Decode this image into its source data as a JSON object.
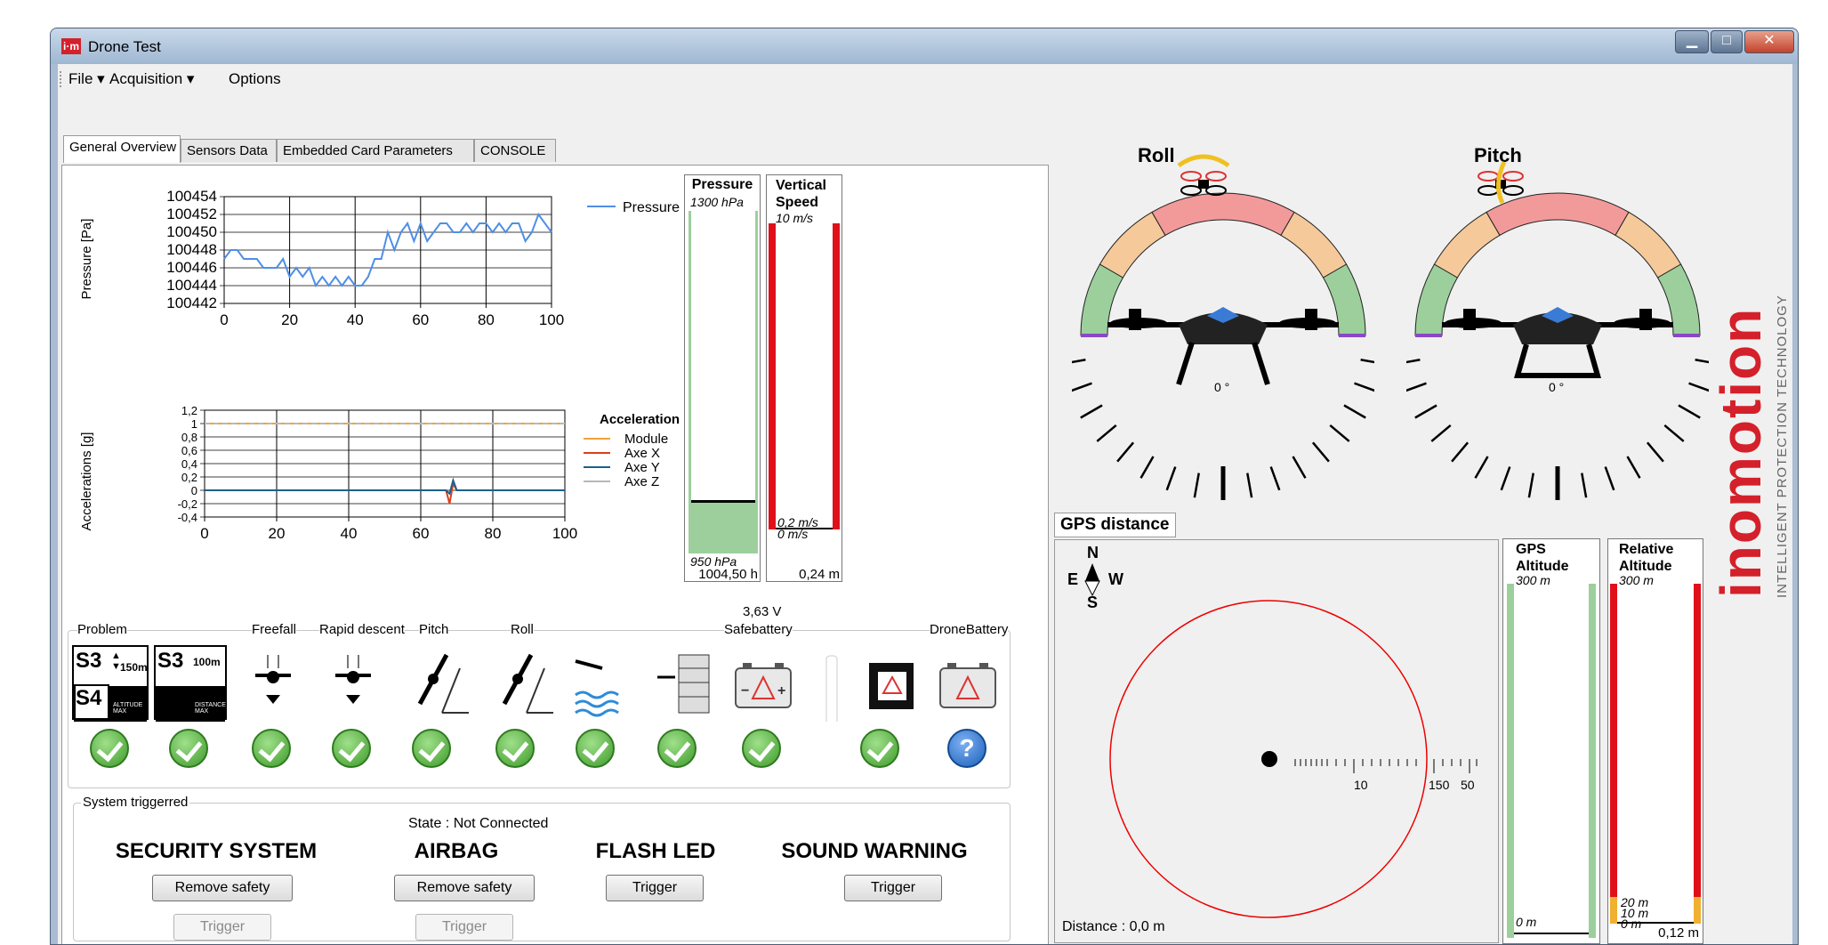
{
  "window": {
    "title": "Drone Test",
    "app_icon_text": "i·m",
    "minimize": "▁",
    "maximize": "□",
    "close": "✕"
  },
  "menu": [
    {
      "label": "File ▾"
    },
    {
      "label": "Acquisition ▾"
    },
    {
      "label": "Options"
    }
  ],
  "tabs": [
    {
      "label": "General Overview"
    },
    {
      "label": "Sensors Data"
    },
    {
      "label": "Embedded Card Parameters"
    },
    {
      "label": "CONSOLE"
    }
  ],
  "chart_data": [
    {
      "type": "line",
      "ylabel": "Pressure [Pa]",
      "xlabel": "",
      "ylim": [
        100442,
        100454
      ],
      "xlim": [
        0,
        100
      ],
      "y_ticks": [
        "100454",
        "100452",
        "100450",
        "100448",
        "100446",
        "100444",
        "100442"
      ],
      "x_ticks": [
        "0",
        "20",
        "40",
        "60",
        "80",
        "100"
      ],
      "legend": "top-right",
      "grid": true,
      "series": [
        {
          "name": "Pressure",
          "color": "#4f8fe6",
          "x": [
            0,
            2,
            4,
            6,
            8,
            10,
            12,
            14,
            16,
            18,
            20,
            22,
            24,
            26,
            28,
            30,
            32,
            34,
            36,
            38,
            40,
            42,
            44,
            46,
            48,
            50,
            52,
            54,
            56,
            58,
            60,
            62,
            64,
            66,
            68,
            70,
            72,
            74,
            76,
            78,
            80,
            82,
            84,
            86,
            88,
            90,
            92,
            94,
            96,
            98,
            100
          ],
          "y": [
            100447,
            100448,
            100448,
            100447,
            100447,
            100447,
            100446,
            100446,
            100446,
            100447,
            100445,
            100446,
            100445,
            100446,
            100444,
            100445,
            100444,
            100445,
            100444,
            100445,
            100444,
            100444,
            100445,
            100447,
            100447,
            100450,
            100448,
            100450,
            100451,
            100449,
            100451,
            100449,
            100450,
            100451,
            100451,
            100450,
            100450,
            100451,
            100450,
            100451,
            100451,
            100450,
            100451,
            100450,
            100451,
            100451,
            100449,
            100450,
            100452,
            100451,
            100450
          ]
        }
      ]
    },
    {
      "type": "line",
      "ylabel": "Accelerations [g]",
      "xlabel": "",
      "ylim": [
        -0.4,
        1.2
      ],
      "xlim": [
        0,
        100
      ],
      "y_ticks": [
        "1,2",
        "1",
        "0,8",
        "0,6",
        "0,4",
        "0,2",
        "0",
        "-0,2",
        "-0,4"
      ],
      "x_ticks": [
        "0",
        "20",
        "40",
        "60",
        "80",
        "100"
      ],
      "legend_title": "Acceleration",
      "legend": "top-right",
      "grid": true,
      "series": [
        {
          "name": "Module",
          "color": "#f2a23a",
          "x": [
            0,
            100
          ],
          "y": [
            1,
            1
          ]
        },
        {
          "name": "Axe X",
          "color": "#d9401a",
          "x": [
            0,
            67,
            68,
            69,
            70,
            100
          ],
          "y": [
            0,
            0,
            -0.2,
            0.1,
            0,
            0
          ]
        },
        {
          "name": "Axe Y",
          "color": "#1f5f8b",
          "x": [
            0,
            67,
            68,
            69,
            70,
            100
          ],
          "y": [
            0,
            0,
            -0.05,
            0.15,
            0,
            0
          ]
        },
        {
          "name": "Axe Z",
          "color": "#b8b8b8",
          "x": [
            0,
            100
          ],
          "y": [
            1,
            1
          ]
        }
      ]
    }
  ],
  "pressure_bar": {
    "title": "Pressure",
    "max_label": "1300 hPa",
    "min_label": "950 hPa",
    "value_label": "1004,50 h",
    "level": 0.155
  },
  "vspeed_bar": {
    "title": "Vertical\nSpeed",
    "max_label": "10 m/s",
    "mid_label": "0,2 m/s",
    "mid_label2": "0 m/s",
    "value_label": "0,24 m",
    "level": 0.02
  },
  "alarms": {
    "labels": {
      "problem": "Problem",
      "freefall": "Freefall",
      "rapid": "Rapid descent",
      "pitch": "Pitch",
      "roll": "Roll",
      "safebattery": "Safebattery",
      "safebattery_value": "3,63 V",
      "dronebattery": "DroneBattery"
    },
    "s3a": "S3",
    "s4": "S4",
    "s3b": "S3",
    "alt_max": "150m",
    "alt_max_caption": "ALTITUDE MAX",
    "dist_max": "100m",
    "dist_max_caption": "DISTANCE MAX",
    "unknown": "?"
  },
  "system": {
    "group_label": "System triggerred",
    "state": "State : Not Connected",
    "security_title": "SECURITY SYSTEM",
    "airbag_title": "AIRBAG",
    "flash_title": "FLASH LED",
    "sound_title": "SOUND WARNING",
    "remove_safety": "Remove safety",
    "trigger": "Trigger"
  },
  "gauges": {
    "roll_title": "Roll",
    "pitch_title": "Pitch",
    "roll_value": "0 °",
    "pitch_value": "0 °",
    "colors": {
      "green": "#9ccf9c",
      "orange": "#f5c99a",
      "red": "#f29a9a",
      "purple": "#8a48c8"
    }
  },
  "gps": {
    "tab": "GPS distance",
    "distance": "Distance : 0,0 m",
    "compass_n": "N",
    "compass_s": "S",
    "compass_e": "E",
    "compass_w": "W",
    "scale_labels": [
      "10",
      "150",
      "50"
    ]
  },
  "gps_alt": {
    "title": "GPS\nAltitude",
    "max_label": "300 m",
    "min_label": "0 m",
    "level": 0.0
  },
  "rel_alt": {
    "title": "Relative\nAltitude",
    "max_label": "300 m",
    "l20": "20 m",
    "l10": "10 m",
    "min_label": "0 m",
    "value_label": "0,12 m",
    "level": 0.0
  },
  "brand": {
    "logo": "inomotion",
    "tagline": "INTELLIGENT PROTECTION TECHNOLOGY",
    "accent": "#d4202a"
  }
}
